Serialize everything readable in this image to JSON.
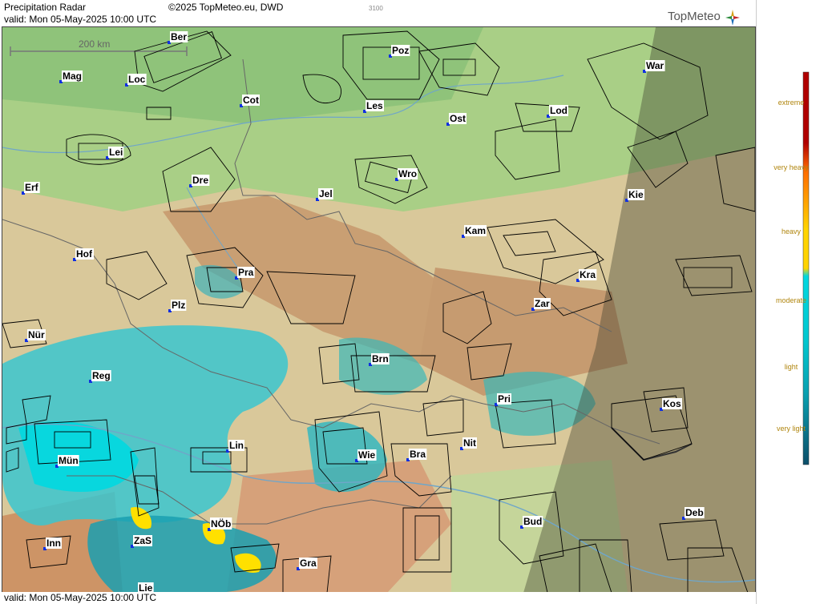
{
  "header": {
    "title": "Precipitation Radar",
    "copyright": "©2025 TopMeteo.eu, DWD",
    "valid": "valid:  Mon  05-May-2025 10:00 UTC",
    "code": "3100",
    "brand": "TopMeteo"
  },
  "footer": {
    "valid": "valid:  Mon  05-May-2025 10:00 UTC"
  },
  "scale_bar": {
    "label": "200 km"
  },
  "legend": {
    "items": [
      {
        "label": "extreme",
        "color": "#b00000"
      },
      {
        "label": "very heavy",
        "color": "#ff6a00"
      },
      {
        "label": "heavy",
        "color": "#ffd400"
      },
      {
        "label": "moderate",
        "color": "#00d8e0"
      },
      {
        "label": "light",
        "color": "#0aa0b0"
      },
      {
        "label": "very light",
        "color": "#0c4f6a"
      }
    ]
  },
  "cities": [
    {
      "name": "Ber"
    },
    {
      "name": "Mag"
    },
    {
      "name": "Loc"
    },
    {
      "name": "Cot"
    },
    {
      "name": "Poz"
    },
    {
      "name": "Les"
    },
    {
      "name": "Ost"
    },
    {
      "name": "War"
    },
    {
      "name": "Lod"
    },
    {
      "name": "Lei"
    },
    {
      "name": "Dre"
    },
    {
      "name": "Wro"
    },
    {
      "name": "Erf"
    },
    {
      "name": "Jel"
    },
    {
      "name": "Kie"
    },
    {
      "name": "Kam"
    },
    {
      "name": "Hof"
    },
    {
      "name": "Pra"
    },
    {
      "name": "Kra"
    },
    {
      "name": "Plz"
    },
    {
      "name": "Zar"
    },
    {
      "name": "Nür"
    },
    {
      "name": "Brn"
    },
    {
      "name": "Reg"
    },
    {
      "name": "Pri"
    },
    {
      "name": "Kos"
    },
    {
      "name": "Lin"
    },
    {
      "name": "Nit"
    },
    {
      "name": "Wie"
    },
    {
      "name": "Bra"
    },
    {
      "name": "Mün"
    },
    {
      "name": "Bud"
    },
    {
      "name": "Deb"
    },
    {
      "name": "NÖb"
    },
    {
      "name": "Inn"
    },
    {
      "name": "ZaS"
    },
    {
      "name": "Gra"
    },
    {
      "name": "Lie"
    }
  ]
}
